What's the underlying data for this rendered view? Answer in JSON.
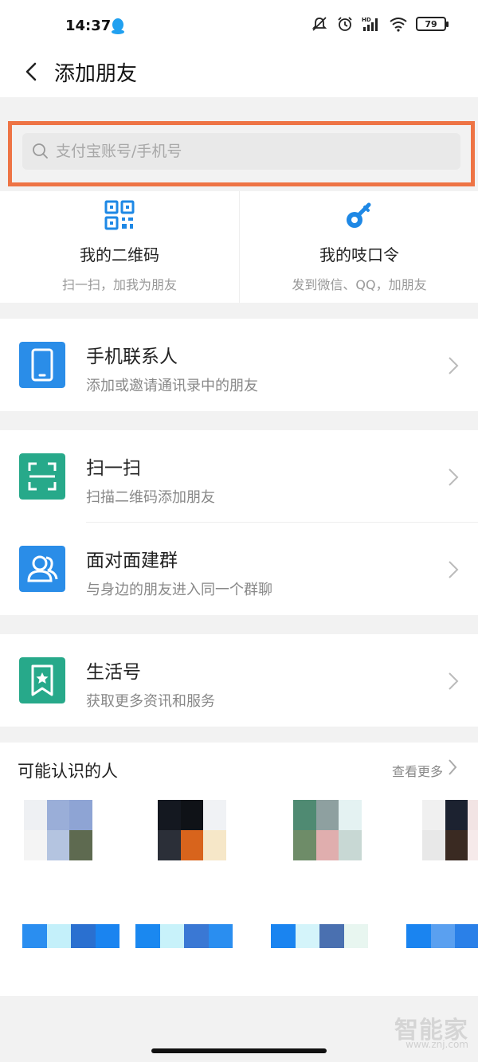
{
  "status_bar": {
    "time": "14:37",
    "battery": "79"
  },
  "navbar": {
    "title": "添加朋友"
  },
  "search": {
    "placeholder": "支付宝账号/手机号",
    "value": ""
  },
  "quick_actions": [
    {
      "title": "我的二维码",
      "subtitle": "扫一扫，加我为朋友",
      "icon": "qr-code-icon"
    },
    {
      "title": "我的吱口令",
      "subtitle": "发到微信、QQ，加朋友",
      "icon": "key-icon"
    }
  ],
  "menu": {
    "contacts": {
      "title": "手机联系人",
      "subtitle": "添加或邀请通讯录中的朋友",
      "icon": "phone-icon",
      "color": "#2a8de8"
    },
    "scan": {
      "title": "扫一扫",
      "subtitle": "扫描二维码添加朋友",
      "icon": "scan-icon",
      "color": "#27a98a"
    },
    "face_group": {
      "title": "面对面建群",
      "subtitle": "与身边的朋友进入同一个群聊",
      "icon": "people-icon",
      "color": "#2a8de8"
    },
    "life": {
      "title": "生活号",
      "subtitle": "获取更多资讯和服务",
      "icon": "bookmark-star-icon",
      "color": "#27a98a"
    }
  },
  "people": {
    "title": "可能认识的人",
    "more": "查看更多"
  },
  "watermark": {
    "brand": "智能家",
    "url": "www.znj.com"
  }
}
